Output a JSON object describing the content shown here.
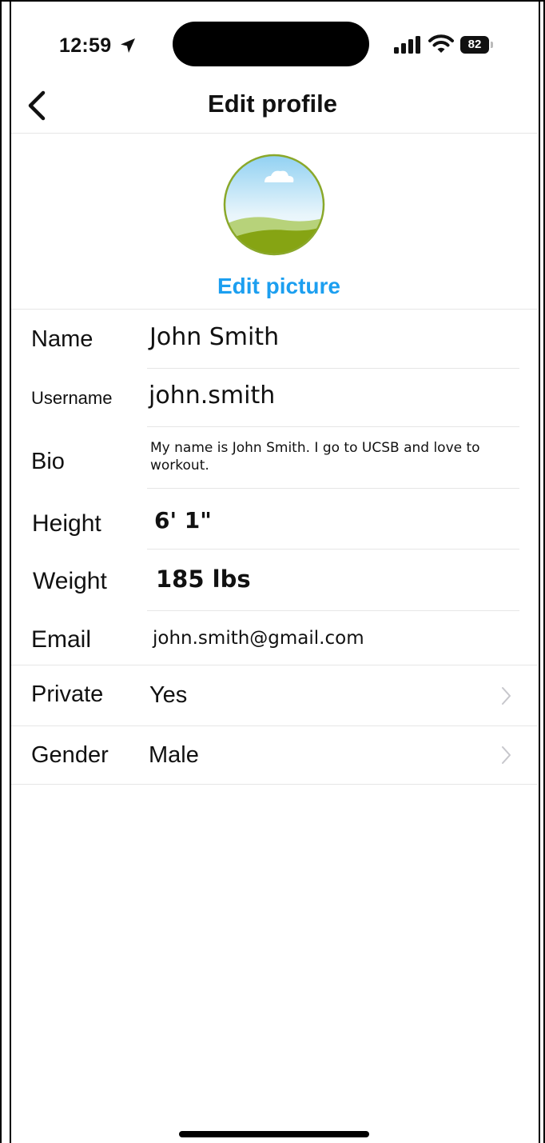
{
  "status_bar": {
    "time": "12:59",
    "battery": "82"
  },
  "header": {
    "title": "Edit profile"
  },
  "avatar": {
    "edit_label": "Edit picture"
  },
  "fields": {
    "name": {
      "label": "Name",
      "value": "John Smith"
    },
    "username": {
      "label": "Username",
      "value": "john.smith"
    },
    "bio": {
      "label": "Bio",
      "value": "My name is John Smith. I go to UCSB and love to workout."
    },
    "height": {
      "label": "Height",
      "value": "6' 1\""
    },
    "weight": {
      "label": "Weight",
      "value": "185 lbs"
    },
    "email": {
      "label": "Email",
      "value": "john.smith@gmail.com"
    },
    "private": {
      "label": "Private",
      "value": "Yes"
    },
    "gender": {
      "label": "Gender",
      "value": "Male"
    }
  },
  "colors": {
    "accent": "#1c9ff0",
    "separator": "#e6e6e6",
    "chevron": "#c7c7cc"
  },
  "icons": [
    "location-arrow-icon",
    "signal-icon",
    "wifi-icon",
    "battery-icon",
    "back-chevron-icon",
    "chevron-right-icon",
    "avatar-landscape-icon"
  ]
}
